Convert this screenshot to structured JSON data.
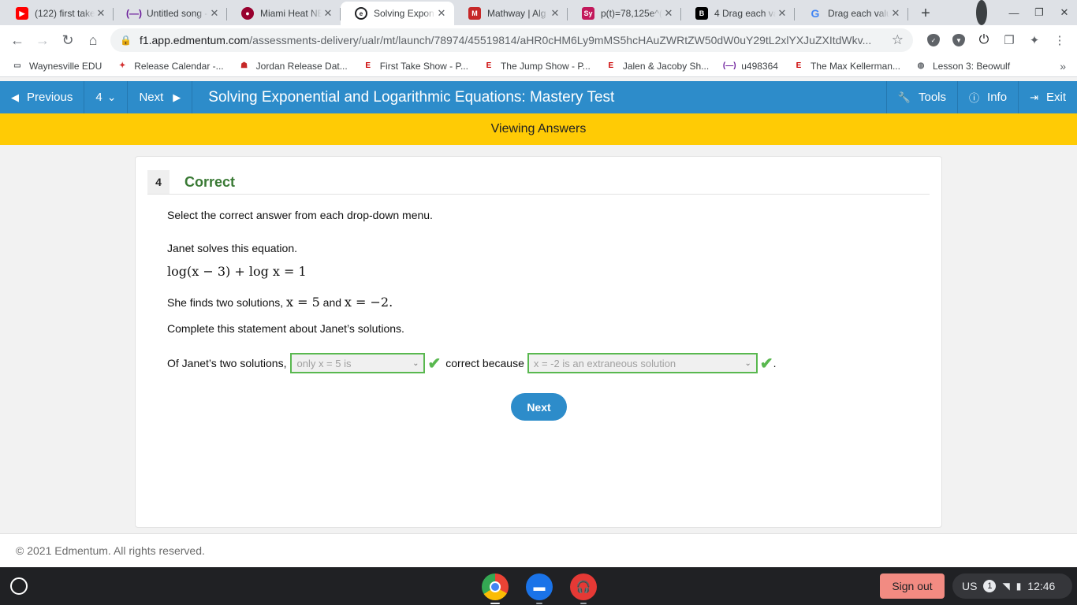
{
  "browser": {
    "tabs": [
      {
        "title": "(122) first take",
        "icon": "youtube-icon",
        "color": "#ff0000"
      },
      {
        "title": "Untitled song -",
        "icon": "audio-icon",
        "color": "#6a1b9a"
      },
      {
        "title": "Miami Heat NE",
        "icon": "heat-icon",
        "color": "#98002e"
      },
      {
        "title": "Solving Expon",
        "icon": "edmentum-icon",
        "color": "#202124",
        "active": true
      },
      {
        "title": "Mathway | Alg",
        "icon": "mathway-icon",
        "color": "#c62828"
      },
      {
        "title": "p(t)=78,125e^(",
        "icon": "symbolab-icon",
        "color": "#c2185b"
      },
      {
        "title": "4 Drag each va",
        "icon": "brainly-icon",
        "color": "#000000"
      },
      {
        "title": "Drag each valu",
        "icon": "google-icon",
        "color": "#4285f4"
      }
    ],
    "url_host": "f1.app.edmentum.com",
    "url_path": "/assessments-delivery/ualr/mt/launch/78974/45519814/aHR0cHM6Ly9mMS5hcHAuZWRtZW50dW0uY29tL2xlYXJuZXItdWkv..."
  },
  "bookmarks": [
    {
      "label": "Waynesville EDU",
      "icon": "folder-icon",
      "color": "#5f6368"
    },
    {
      "label": "Release Calendar -...",
      "icon": "bookmark-site-icon",
      "color": "#d32f2f"
    },
    {
      "label": "Jordan Release Dat...",
      "icon": "bookmark-site-icon",
      "color": "#c62828"
    },
    {
      "label": "First Take Show - P...",
      "icon": "espn-icon",
      "color": "#cc0000"
    },
    {
      "label": "The Jump Show - P...",
      "icon": "espn-icon",
      "color": "#cc0000"
    },
    {
      "label": "Jalen & Jacoby Sh...",
      "icon": "espn-icon",
      "color": "#cc0000"
    },
    {
      "label": "u498364",
      "icon": "audio-icon",
      "color": "#6a1b9a"
    },
    {
      "label": "The Max Kellerman...",
      "icon": "espn-icon",
      "color": "#cc0000"
    },
    {
      "label": "Lesson 3: Beowulf",
      "icon": "globe-icon",
      "color": "#5f6368"
    }
  ],
  "app": {
    "previous_label": "Previous",
    "question_number": "4",
    "next_label": "Next",
    "title": "Solving Exponential and Logarithmic Equations: Mastery Test",
    "tools_label": "Tools",
    "info_label": "Info",
    "exit_label": "Exit",
    "banner": "Viewing Answers",
    "accent_color": "#2d8cca",
    "banner_color": "#ffcb05"
  },
  "question": {
    "number": "4",
    "status": "Correct",
    "instruction": "Select the correct answer from each drop-down menu.",
    "intro": "Janet solves this equation.",
    "equation": "log(x − 3) + log x = 1",
    "solutions_text_prefix": "She finds two solutions,",
    "solution_one": "x = 5",
    "solutions_and": "and",
    "solution_two": "x = −2.",
    "prompt": "Complete this statement about Janet’s solutions.",
    "statement_start": "Of Janet’s two solutions,",
    "dropdown_one_value": "only x = 5 is",
    "statement_middle": "correct because",
    "dropdown_two_value": "x = -2 is an extraneous solution",
    "statement_end": ".",
    "next_button": "Next",
    "correct_color": "#3a7a35"
  },
  "footer": {
    "copyright": "© 2021 Edmentum. All rights reserved."
  },
  "shelf": {
    "apps": [
      {
        "name": "chrome-icon",
        "color": "#4285f4"
      },
      {
        "name": "files-icon",
        "color": "#1a73e8"
      },
      {
        "name": "music-icon",
        "color": "#e53935"
      }
    ],
    "signout": "Sign out",
    "keyboard": "US",
    "notifications": "1",
    "time": "12:46"
  }
}
